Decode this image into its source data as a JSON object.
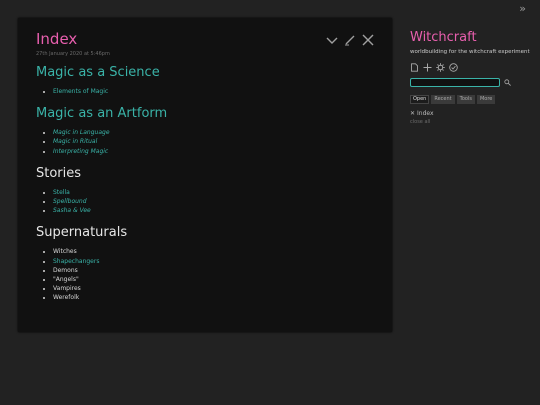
{
  "topbar": {
    "expand_icon": "double-chevron-right-icon",
    "expand_glyph": "»"
  },
  "tiddler": {
    "title": "Index",
    "subtitle": "27th January 2020 at 5:46pm",
    "controls": [
      "chevron-down-icon",
      "edit-pencil-icon",
      "close-icon"
    ],
    "sections": [
      {
        "heading": "Magic as a Science",
        "heading_is_link": true,
        "items": [
          {
            "text": "Elements of Magic",
            "style": "link"
          }
        ]
      },
      {
        "heading": "Magic as an Artform",
        "heading_is_link": true,
        "items": [
          {
            "text": "Magic in Language",
            "style": "italic-link"
          },
          {
            "text": "Magic in Ritual",
            "style": "italic-link"
          },
          {
            "text": "Interpreting Magic",
            "style": "italic-link"
          }
        ]
      },
      {
        "heading": "Stories",
        "heading_is_link": false,
        "items": [
          {
            "text": "Stella",
            "style": "link"
          },
          {
            "text": "Spellbound",
            "style": "italic-link"
          },
          {
            "text": "Sasha & Vee",
            "style": "italic-link"
          }
        ]
      },
      {
        "heading": "Supernaturals",
        "heading_is_link": false,
        "items": [
          {
            "text": "Witches",
            "style": "plain"
          },
          {
            "text": "Shapechangers",
            "style": "link"
          },
          {
            "text": "Demons",
            "style": "plain"
          },
          {
            "text": "\"Angels\"",
            "style": "plain"
          },
          {
            "text": "Vampires",
            "style": "plain"
          },
          {
            "text": "Werefolk",
            "style": "plain"
          }
        ]
      }
    ]
  },
  "sidebar": {
    "title": "Witchcraft",
    "subtitle": "worldbuilding for the witchcraft experiment",
    "page_controls": [
      "new-tiddler-icon",
      "plus-icon",
      "gear-icon",
      "check-circle-icon"
    ],
    "search": {
      "value": "",
      "placeholder": "",
      "button_icon": "search-icon"
    },
    "tabs": [
      {
        "label": "Open",
        "active": true
      },
      {
        "label": "Recent",
        "active": false
      },
      {
        "label": "Tools",
        "active": false
      },
      {
        "label": "More",
        "active": false
      }
    ],
    "open_items": [
      {
        "label": "Index",
        "close_glyph": "✕"
      }
    ],
    "close_all_label": "close all"
  },
  "colors": {
    "background": "#222222",
    "panel": "#111111",
    "title_pink": "#e85fae",
    "link_teal": "#3ab3a8",
    "text": "#d8d8d8"
  }
}
